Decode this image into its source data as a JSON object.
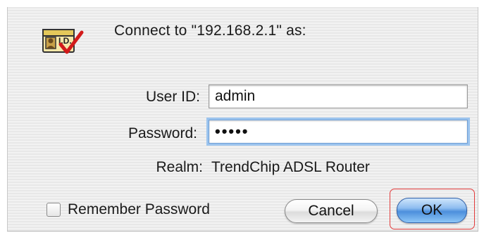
{
  "dialog": {
    "prompt": "Connect to \"192.168.2.1\" as:",
    "icon": "id-card-check-icon"
  },
  "fields": {
    "userid_label": "User ID:",
    "userid_value": "admin",
    "password_label": "Password:",
    "password_value": "•••••",
    "realm_label": "Realm:",
    "realm_value": "TrendChip ADSL Router"
  },
  "options": {
    "remember_label": "Remember Password",
    "remember_checked": false
  },
  "buttons": {
    "cancel": "Cancel",
    "ok": "OK"
  },
  "colors": {
    "focus_ring": "#9cc4ee",
    "ok_button": "#4d8fdc",
    "highlight": "#e23b3b"
  }
}
